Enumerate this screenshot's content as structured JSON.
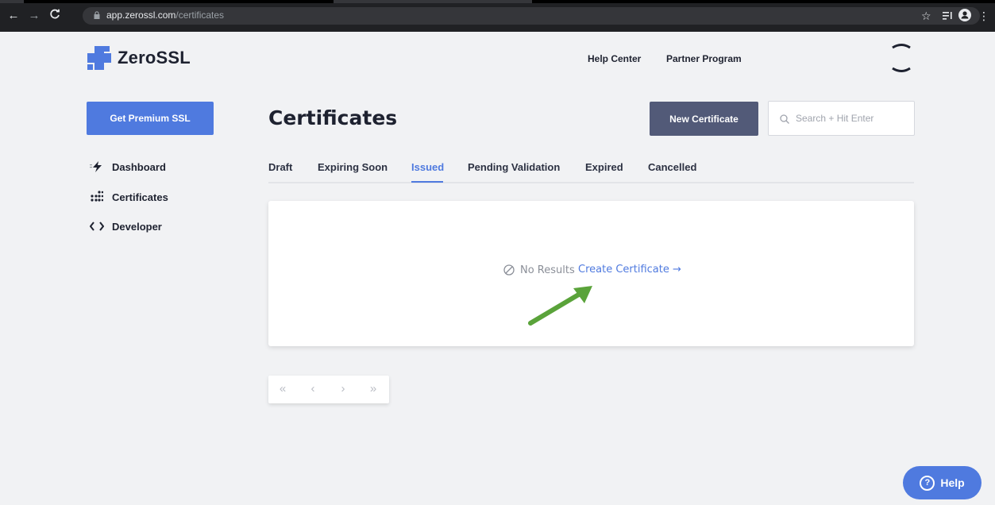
{
  "browser": {
    "url_domain": "app.zerossl.com",
    "url_path": "/certificates",
    "back_icon": "arrow-left",
    "forward_icon": "arrow-right",
    "reload_icon": "reload",
    "star_icon": "star",
    "menu_icon": "kebab"
  },
  "header": {
    "brand": "ZeroSSL",
    "nav": [
      "Help Center",
      "Partner Program"
    ]
  },
  "sidebar": {
    "cta_label": "Get Premium SSL",
    "items": [
      {
        "label": "Dashboard",
        "icon": "bolt-icon"
      },
      {
        "label": "Certificates",
        "icon": "grid-dots-icon"
      },
      {
        "label": "Developer",
        "icon": "code-icon"
      }
    ]
  },
  "main": {
    "title": "Certificates",
    "new_button": "New Certificate",
    "search_placeholder": "Search + Hit Enter",
    "tabs": [
      "Draft",
      "Expiring Soon",
      "Issued",
      "Pending Validation",
      "Expired",
      "Cancelled"
    ],
    "active_tab": "Issued",
    "empty_text": "No Results",
    "create_link": "Create Certificate →"
  },
  "pagination": {
    "first": "«",
    "prev": "‹",
    "next": "›",
    "last": "»"
  },
  "help_button": "Help",
  "colors": {
    "accent": "#4f7adf",
    "dark_button": "#525a78",
    "annotation_arrow": "#5aa33a"
  }
}
